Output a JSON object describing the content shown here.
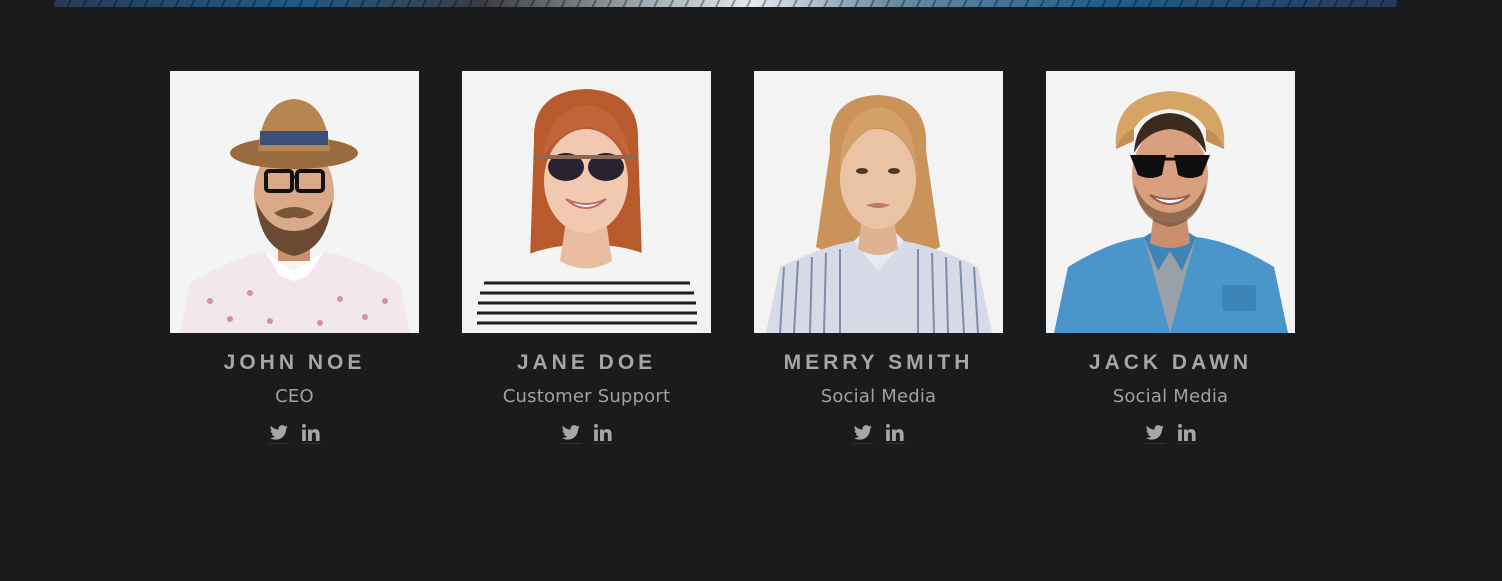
{
  "team": {
    "members": [
      {
        "name": "John Noe",
        "role": "CEO",
        "social": [
          "twitter-icon",
          "linkedin-icon"
        ],
        "colors": {
          "skin": "#d9a98a",
          "hair": "#6b4a32",
          "shirt": "#f1e7ec",
          "hat": "#b5864f",
          "hatband": "#3c4f78"
        }
      },
      {
        "name": "Jane Doe",
        "role": "Customer Support",
        "social": [
          "twitter-icon",
          "linkedin-icon"
        ],
        "colors": {
          "skin": "#f1c9b0",
          "hair": "#b85a2c",
          "shirt": "#f4f4f4",
          "stripes": "#1e1e1e"
        }
      },
      {
        "name": "Merry Smith",
        "role": "Social Media",
        "social": [
          "twitter-icon",
          "linkedin-icon"
        ],
        "colors": {
          "skin": "#eac3a5",
          "hair": "#c99359",
          "shirt": "#d7dbe8",
          "stripes": "#7f8cae"
        }
      },
      {
        "name": "Jack Dawn",
        "role": "Social Media",
        "social": [
          "twitter-icon",
          "linkedin-icon"
        ],
        "colors": {
          "skin": "#d8a07e",
          "hair": "#3d2a1f",
          "shirt": "#4a95c9",
          "hat": "#d6a565",
          "tee": "#9aa0a8"
        }
      }
    ]
  },
  "theme": {
    "background": "#1a1b1d",
    "name_color": "#a8a6a2",
    "role_color": "#a3a19d",
    "icon_color": "#a8a6a2"
  }
}
